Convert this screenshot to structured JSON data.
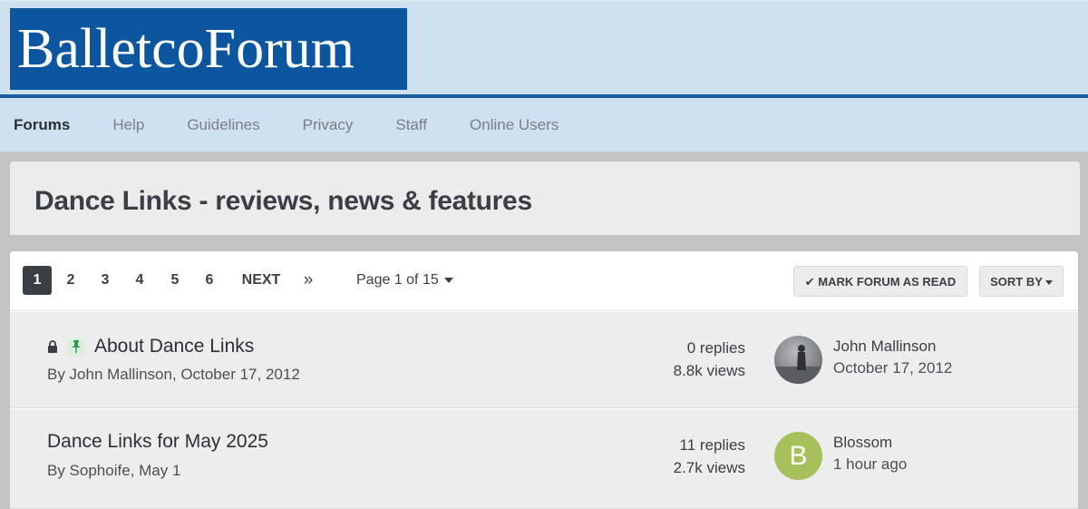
{
  "site": {
    "logo_text": "BalletcoForum"
  },
  "nav": {
    "items": [
      {
        "label": "Forums",
        "active": true
      },
      {
        "label": "Help"
      },
      {
        "label": "Guidelines"
      },
      {
        "label": "Privacy"
      },
      {
        "label": "Staff"
      },
      {
        "label": "Online Users"
      }
    ]
  },
  "page": {
    "title": "Dance Links - reviews, news & features"
  },
  "pagination": {
    "pages": [
      "1",
      "2",
      "3",
      "4",
      "5",
      "6"
    ],
    "current": "1",
    "next_label": "NEXT",
    "last_label": "»",
    "page_info": "Page 1 of 15"
  },
  "actions": {
    "mark_read_label": "✔ MARK FORUM AS READ",
    "sort_label": "SORT BY"
  },
  "topics": [
    {
      "title": "About Dance Links",
      "meta": "By John Mallinson, October 17, 2012",
      "replies": "0 replies",
      "views": "8.8k views",
      "last_poster": "John Mallinson",
      "last_time": "October 17, 2012",
      "icons": [
        "lock-icon",
        "pin-icon"
      ]
    },
    {
      "title": "Dance Links for May 2025",
      "meta": "By Sophoife, May 1",
      "replies": "11 replies",
      "views": "2.7k views",
      "last_poster": "Blossom",
      "last_time": "1 hour ago",
      "avatar_letter": "B"
    }
  ],
  "colors": {
    "header_bg": "#cfe0f1",
    "logo_bg": "#0c56a0",
    "accent_line": "#1b5e9e",
    "avatar_green": "#a6c15b"
  }
}
